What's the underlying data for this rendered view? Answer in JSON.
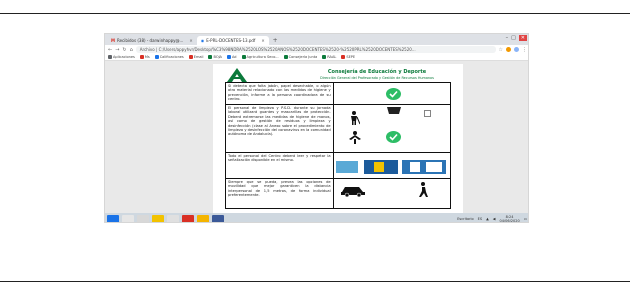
{
  "browser": {
    "tabs": [
      {
        "label": "Recibidos (38) - darwinhappy@...",
        "active": false
      },
      {
        "label": "E-PRL-DOCENTES-13.pdf",
        "active": true
      }
    ],
    "new_tab": "+",
    "url": "Archivo | C:/Users/appyhvr/Desktop/%C3%98NDRA%2520LOS%2520ANOS%2520DOCENTES%2520-%2520PRL%2520DOCENTES%2520...",
    "bookmarks": [
      "Aplicaciones",
      "Ms",
      "Calificaciones",
      "Email",
      "BOJA",
      "Ad",
      "Agricultura Seco...",
      "Consejería Junta",
      "RAAL",
      "SEPE"
    ]
  },
  "document": {
    "header_title": "Consejería de Educación y Deporte",
    "header_subtitle": "Dirección General del Profesorado y Gestión de Recursos Humanos",
    "rows": [
      {
        "text": "Si detecta que falta jabón, papel desechable, o algún otro material relacionado con las medidas de higiene y prevención, informe a la persona coordinadora de su centro.",
        "pictograms": [
          "check-icon"
        ]
      },
      {
        "text": "El personal de limpieza y P.S.D. durante su jornada laboral utilizará guantes y mascarillas de protección. Deberá extremarse las medidas de higiene de manos, así como de gestión de residuos y limpieza y desinfección (clase al Anexo sobre el procedimiento de limpieza y desinfección del coronavirus en la comunidad autónoma de Andalucía).",
        "pictograms": [
          "cleaner-icon",
          "check-icon"
        ]
      },
      {
        "text": "Todo el personal del Centro deberá leer y respetar la señalización disponible en el mismo.",
        "pictograms": [
          "signage-icon"
        ]
      },
      {
        "text": "Siempre que se pueda, prevea las opciones de movilidad que mejor garanticen la distancia interpersonal de 1,5 metros, de forma individual preferentemente.",
        "pictograms": [
          "car-icon",
          "walking-icon"
        ]
      }
    ]
  },
  "taskbar": {
    "language": "ES",
    "time": "8:24",
    "date": "04/06/2020",
    "tray_label": "Escritorio"
  },
  "colors": {
    "brand_green": "#0b7a3b",
    "check_green": "#2dbd66",
    "taskbar": "#cfd8e0"
  }
}
